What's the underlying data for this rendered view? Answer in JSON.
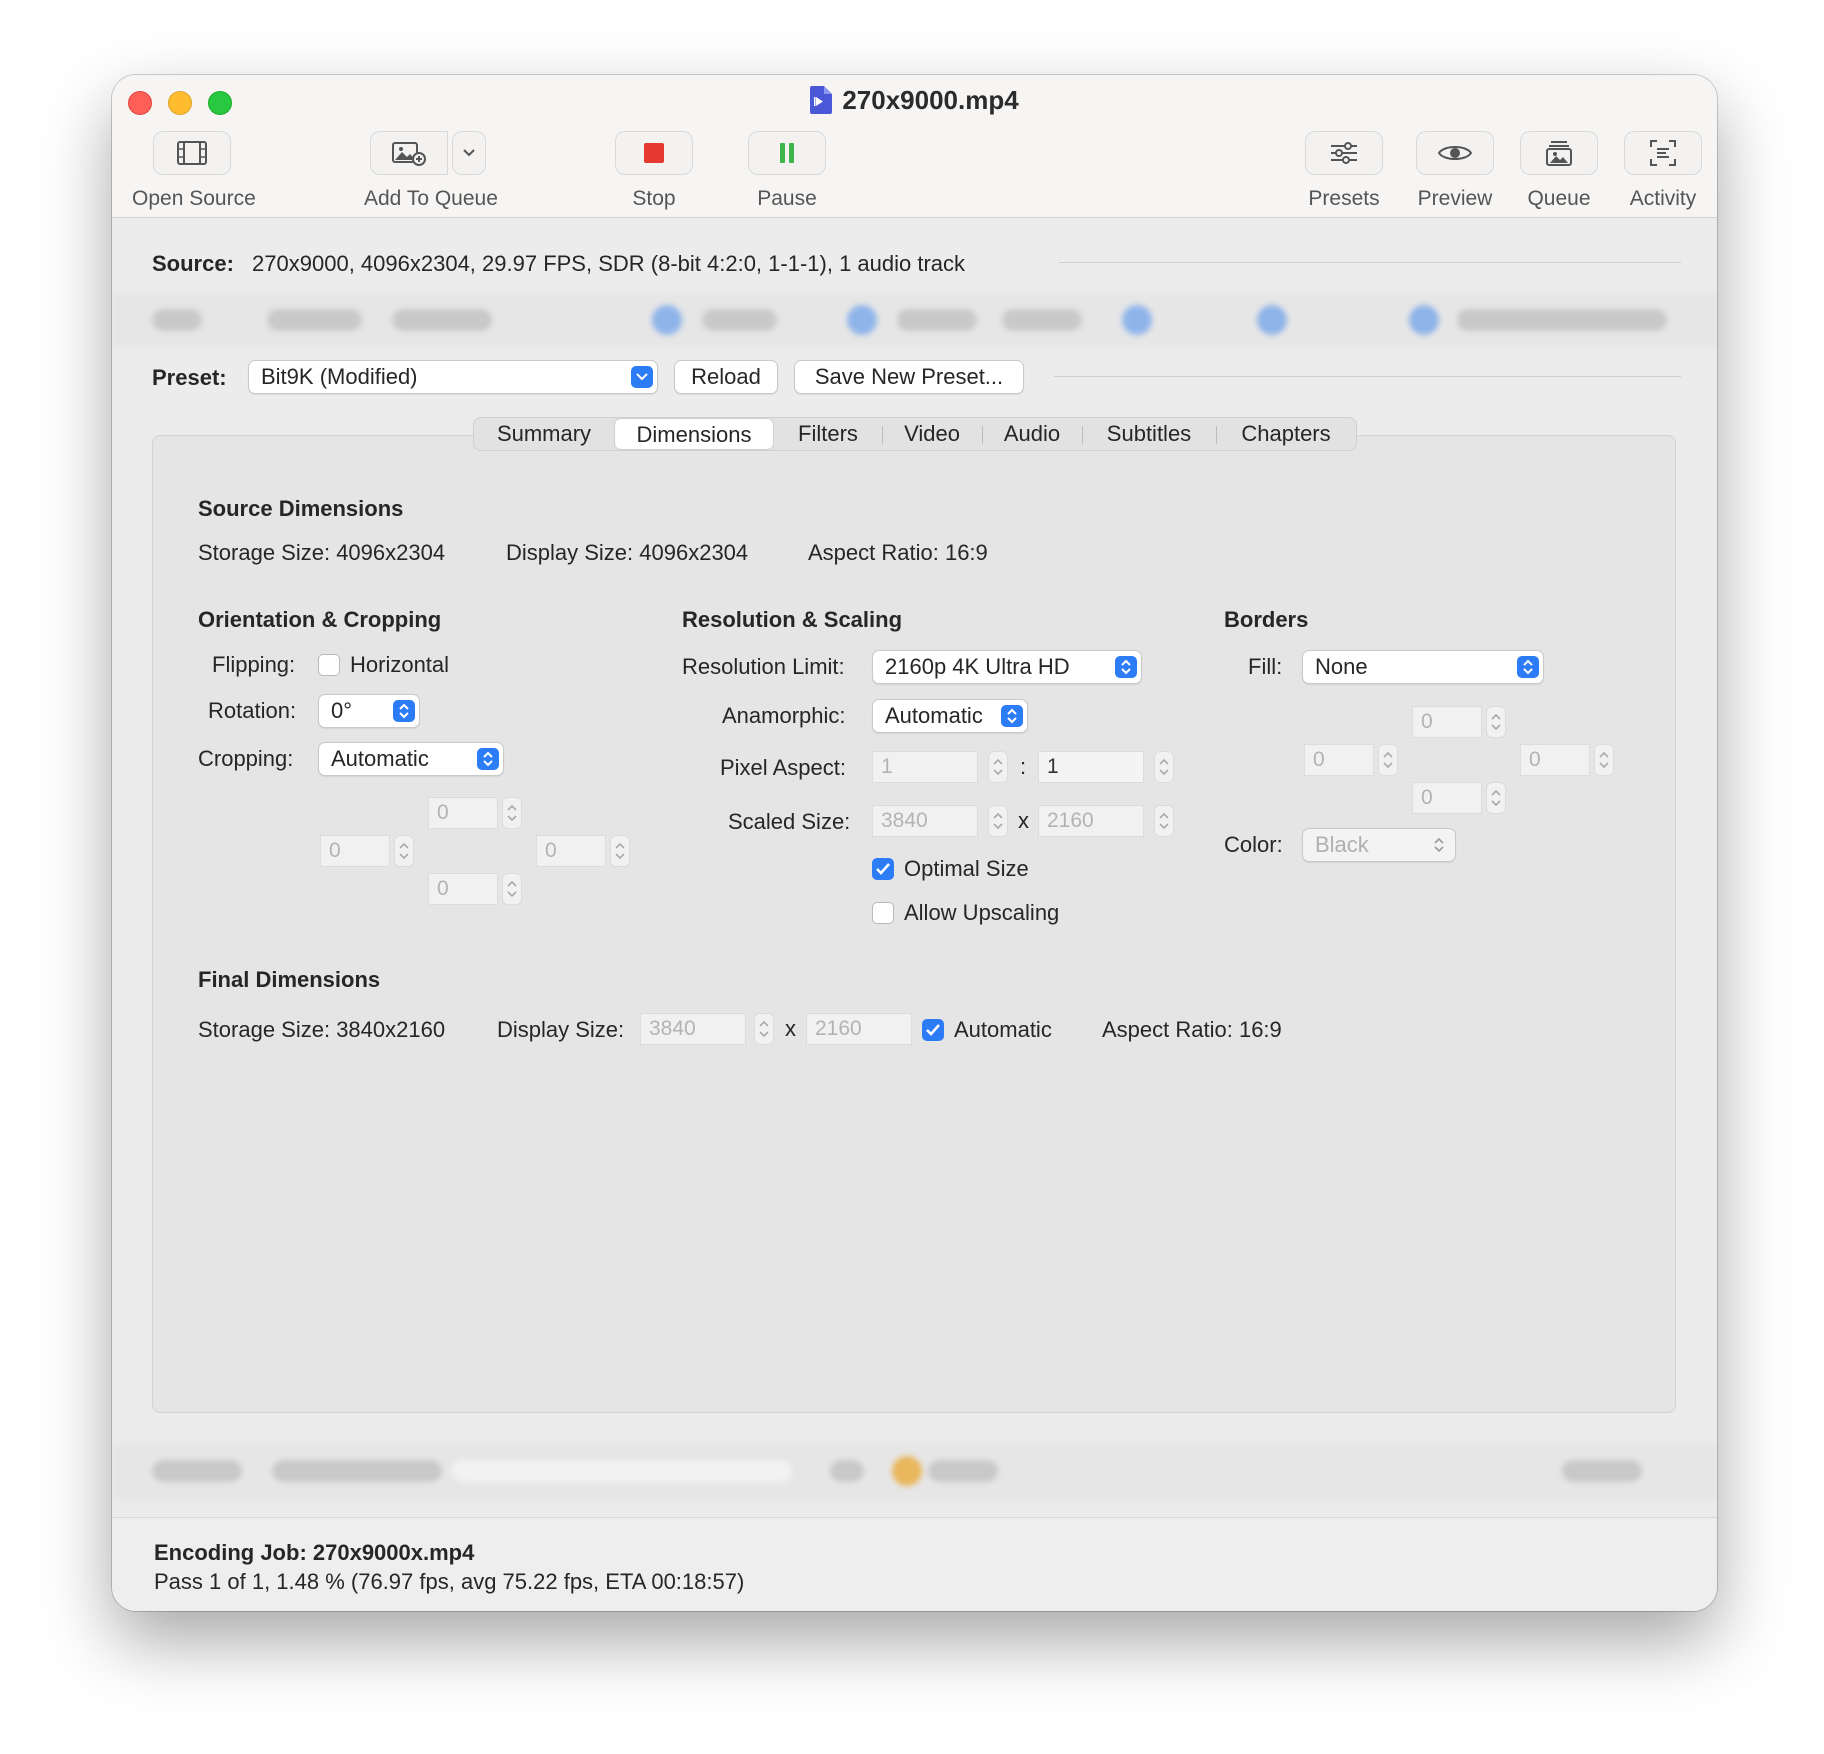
{
  "window": {
    "title": "270x9000.mp4"
  },
  "toolbar": {
    "open_source": "Open Source",
    "add_to_queue": "Add To Queue",
    "stop": "Stop",
    "pause": "Pause",
    "presets": "Presets",
    "preview": "Preview",
    "queue": "Queue",
    "activity": "Activity"
  },
  "source": {
    "label": "Source:",
    "value": "270x9000, 4096x2304, 29.97 FPS, SDR (8-bit 4:2:0, 1-1-1), 1 audio track"
  },
  "preset": {
    "label": "Preset:",
    "selected": "Bit9K (Modified)",
    "reload": "Reload",
    "save_new": "Save New Preset..."
  },
  "tabs": [
    "Summary",
    "Dimensions",
    "Filters",
    "Video",
    "Audio",
    "Subtitles",
    "Chapters"
  ],
  "source_dimensions": {
    "title": "Source Dimensions",
    "storage": "Storage Size: 4096x2304",
    "display": "Display Size: 4096x2304",
    "aspect": "Aspect Ratio:  16:9"
  },
  "orientation": {
    "title": "Orientation & Cropping",
    "flipping_label": "Flipping:",
    "horizontal": "Horizontal",
    "rotation_label": "Rotation:",
    "rotation_value": "0°",
    "cropping_label": "Cropping:",
    "cropping_value": "Automatic",
    "crop_top": "0",
    "crop_left": "0",
    "crop_right": "0",
    "crop_bottom": "0"
  },
  "resolution": {
    "title": "Resolution & Scaling",
    "limit_label": "Resolution Limit:",
    "limit_value": "2160p 4K Ultra HD",
    "anamorphic_label": "Anamorphic:",
    "anamorphic_value": "Automatic",
    "pixel_aspect_label": "Pixel Aspect:",
    "pixel_aspect_w": "1",
    "pixel_aspect_sep": ":",
    "pixel_aspect_h": "1",
    "scaled_label": "Scaled Size:",
    "scaled_w": "3840",
    "scaled_sep": "x",
    "scaled_h": "2160",
    "optimal_size": "Optimal Size",
    "allow_upscaling": "Allow Upscaling"
  },
  "borders": {
    "title": "Borders",
    "fill_label": "Fill:",
    "fill_value": "None",
    "top": "0",
    "left": "0",
    "right": "0",
    "bottom": "0",
    "color_label": "Color:",
    "color_value": "Black"
  },
  "final_dimensions": {
    "title": "Final Dimensions",
    "storage": "Storage Size: 3840x2160",
    "display_label": "Display Size:",
    "display_w": "3840",
    "display_sep": "x",
    "display_h": "2160",
    "automatic": "Automatic",
    "aspect": "Aspect Ratio:  16:9"
  },
  "status": {
    "job": "Encoding Job: 270x9000x.mp4",
    "progress": "Pass 1 of 1, 1.48 % (76.97 fps, avg 75.22 fps, ETA 00:18:57)"
  },
  "colors": {
    "accent": "#2c7cf6",
    "stop": "#e5392f",
    "pause": "#3db54a"
  }
}
